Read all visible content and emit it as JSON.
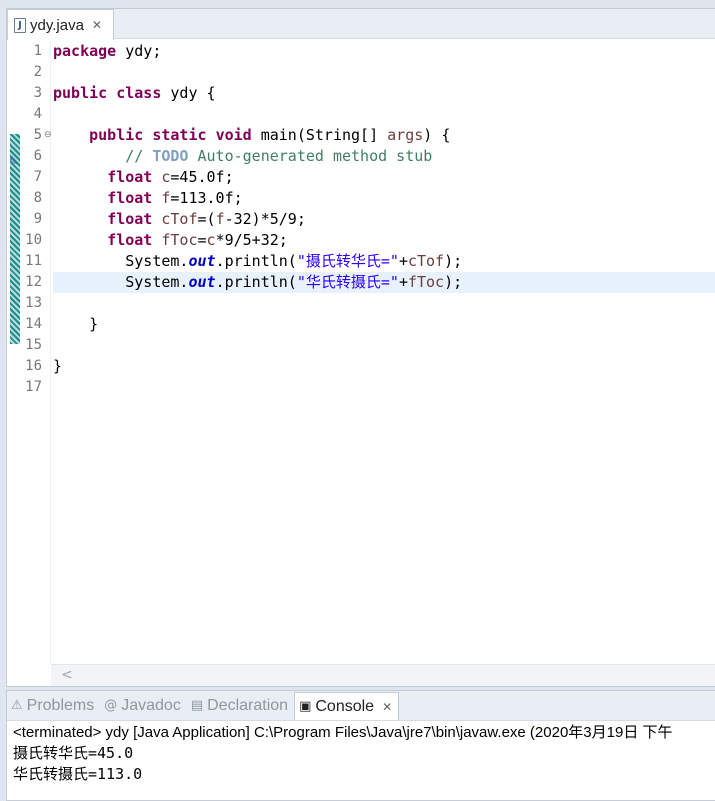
{
  "editor": {
    "tab_label": "ydy.java",
    "tab_icon": "java-file-icon",
    "close_glyph": "✕",
    "current_line": 12
  },
  "code_lines": [
    {
      "n": "1",
      "fold": "",
      "segments": [
        {
          "t": "package",
          "c": "kw"
        },
        {
          "t": " ydy;",
          "c": ""
        }
      ]
    },
    {
      "n": "2",
      "fold": "",
      "segments": []
    },
    {
      "n": "3",
      "fold": "",
      "segments": [
        {
          "t": "public",
          "c": "kw"
        },
        {
          "t": " ",
          "c": ""
        },
        {
          "t": "class",
          "c": "kw"
        },
        {
          "t": " ydy {",
          "c": ""
        }
      ]
    },
    {
      "n": "4",
      "fold": "",
      "segments": []
    },
    {
      "n": "5",
      "fold": "⊖",
      "segments": [
        {
          "t": "    ",
          "c": ""
        },
        {
          "t": "public",
          "c": "kw"
        },
        {
          "t": " ",
          "c": ""
        },
        {
          "t": "static",
          "c": "kw"
        },
        {
          "t": " ",
          "c": ""
        },
        {
          "t": "void",
          "c": "kw"
        },
        {
          "t": " main(String[] ",
          "c": ""
        },
        {
          "t": "args",
          "c": "var"
        },
        {
          "t": ") {",
          "c": ""
        }
      ]
    },
    {
      "n": "6",
      "fold": "",
      "segments": [
        {
          "t": "        ",
          "c": ""
        },
        {
          "t": "// ",
          "c": "cmt"
        },
        {
          "t": "TODO",
          "c": "todo"
        },
        {
          "t": " Auto-generated method stub",
          "c": "cmt"
        }
      ]
    },
    {
      "n": "7",
      "fold": "",
      "segments": [
        {
          "t": "      ",
          "c": ""
        },
        {
          "t": "float",
          "c": "kw"
        },
        {
          "t": " ",
          "c": ""
        },
        {
          "t": "c",
          "c": "var"
        },
        {
          "t": "=45.0f;",
          "c": ""
        }
      ]
    },
    {
      "n": "8",
      "fold": "",
      "segments": [
        {
          "t": "      ",
          "c": ""
        },
        {
          "t": "float",
          "c": "kw"
        },
        {
          "t": " ",
          "c": ""
        },
        {
          "t": "f",
          "c": "var"
        },
        {
          "t": "=113.0f;",
          "c": ""
        }
      ]
    },
    {
      "n": "9",
      "fold": "",
      "segments": [
        {
          "t": "      ",
          "c": ""
        },
        {
          "t": "float",
          "c": "kw"
        },
        {
          "t": " ",
          "c": ""
        },
        {
          "t": "cTof",
          "c": "var"
        },
        {
          "t": "=(",
          "c": ""
        },
        {
          "t": "f",
          "c": "var"
        },
        {
          "t": "-32)*5/9;",
          "c": ""
        }
      ]
    },
    {
      "n": "10",
      "fold": "",
      "segments": [
        {
          "t": "      ",
          "c": ""
        },
        {
          "t": "float",
          "c": "kw"
        },
        {
          "t": " ",
          "c": ""
        },
        {
          "t": "fToc",
          "c": "var"
        },
        {
          "t": "=",
          "c": ""
        },
        {
          "t": "c",
          "c": "var"
        },
        {
          "t": "*9/5+32;",
          "c": ""
        }
      ]
    },
    {
      "n": "11",
      "fold": "",
      "segments": [
        {
          "t": "        System.",
          "c": ""
        },
        {
          "t": "out",
          "c": "fld"
        },
        {
          "t": ".println(",
          "c": ""
        },
        {
          "t": "\"摄氏转华氏=\"",
          "c": "str"
        },
        {
          "t": "+",
          "c": ""
        },
        {
          "t": "cTof",
          "c": "var"
        },
        {
          "t": ");",
          "c": ""
        }
      ]
    },
    {
      "n": "12",
      "fold": "",
      "segments": [
        {
          "t": "        System.",
          "c": ""
        },
        {
          "t": "out",
          "c": "fld"
        },
        {
          "t": ".println(",
          "c": ""
        },
        {
          "t": "\"华氏转摄氏=\"",
          "c": "str"
        },
        {
          "t": "+",
          "c": ""
        },
        {
          "t": "fToc",
          "c": "var"
        },
        {
          "t": ");",
          "c": ""
        }
      ]
    },
    {
      "n": "13",
      "fold": "",
      "segments": []
    },
    {
      "n": "14",
      "fold": "",
      "segments": [
        {
          "t": "    }",
          "c": ""
        }
      ]
    },
    {
      "n": "15",
      "fold": "",
      "segments": []
    },
    {
      "n": "16",
      "fold": "",
      "segments": [
        {
          "t": "}",
          "c": ""
        }
      ]
    },
    {
      "n": "17",
      "fold": "",
      "segments": []
    }
  ],
  "bottom_tabs": [
    {
      "label": "Problems",
      "icon": "problems-icon",
      "glyph": "⚠",
      "active": false
    },
    {
      "label": "Javadoc",
      "icon": "javadoc-icon",
      "glyph": "@",
      "active": false
    },
    {
      "label": "Declaration",
      "icon": "declaration-icon",
      "glyph": "▤",
      "active": false
    },
    {
      "label": "Console",
      "icon": "console-icon",
      "glyph": "▣",
      "active": true
    }
  ],
  "console": {
    "status": "<terminated> ydy [Java Application] C:\\Program Files\\Java\\jre7\\bin\\javaw.exe (2020年3月19日 下午",
    "output": [
      "摄氏转华氏=45.0",
      "华氏转摄氏=113.0"
    ]
  },
  "scroll_left_glyph": "<"
}
